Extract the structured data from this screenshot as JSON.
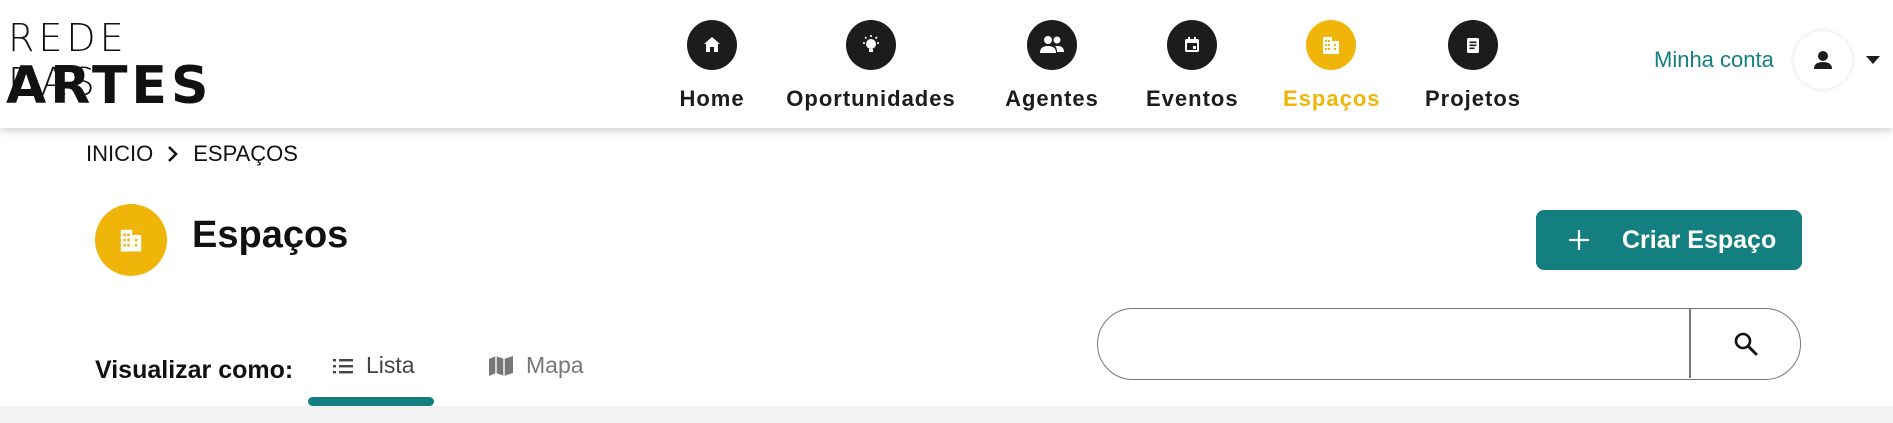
{
  "logo": {
    "line1": "REDE DAS",
    "line2": "ARTES"
  },
  "nav": [
    {
      "label": "Home",
      "icon": "home-icon"
    },
    {
      "label": "Oportunidades",
      "icon": "lightbulb-icon"
    },
    {
      "label": "Agentes",
      "icon": "people-icon"
    },
    {
      "label": "Eventos",
      "icon": "calendar-icon"
    },
    {
      "label": "Espaços",
      "icon": "building-icon",
      "active": true
    },
    {
      "label": "Projetos",
      "icon": "document-icon"
    }
  ],
  "account": {
    "label": "Minha conta",
    "icon": "user-icon"
  },
  "breadcrumb": {
    "home": "INICIO",
    "current": "ESPAÇOS"
  },
  "page": {
    "title": "Espaços",
    "icon": "building-icon"
  },
  "create_button": {
    "label": "Criar Espaço",
    "icon": "plus-icon"
  },
  "view": {
    "label": "Visualizar como:",
    "tabs": [
      {
        "label": "Lista",
        "icon": "list-icon",
        "active": true
      },
      {
        "label": "Mapa",
        "icon": "map-icon"
      }
    ]
  },
  "search": {
    "value": "",
    "placeholder": ""
  },
  "colors": {
    "accent": "#137f80",
    "active": "#f0b509",
    "dark": "#1c1c1c"
  }
}
